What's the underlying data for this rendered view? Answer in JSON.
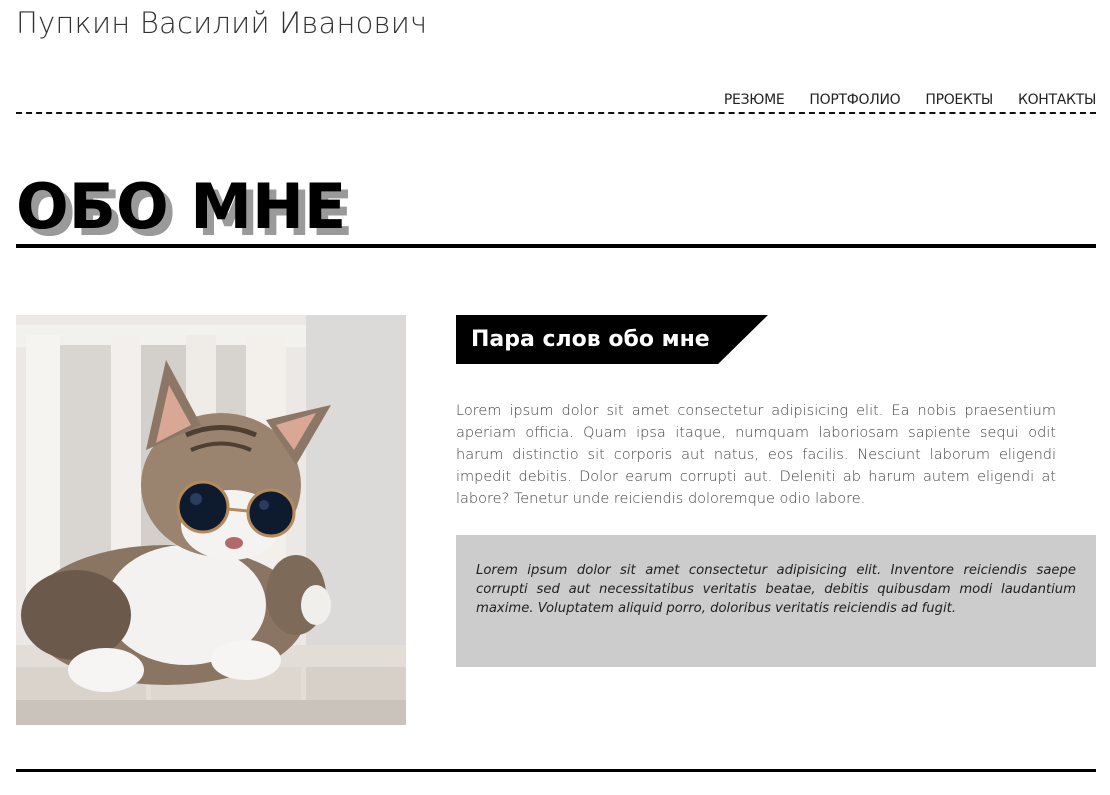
{
  "header": {
    "site_title": "Пупкин Василий Иванович"
  },
  "nav": {
    "items": [
      {
        "label": "РЕЗЮМЕ"
      },
      {
        "label": "ПОРТФОЛИО"
      },
      {
        "label": "ПРОЕКТЫ"
      },
      {
        "label": "КОНТАКТЫ"
      }
    ]
  },
  "main": {
    "heading": "ОБО МНЕ",
    "photo": {
      "alt": "Кот в солнцезащитных очках"
    },
    "subheading": "Пара слов обо мне",
    "intro_text": "Lorem ipsum dolor sit amet consectetur adipisicing elit. Ea nobis praesentium aperiam officia. Quam ipsa itaque, numquam laboriosam sapiente sequi odit harum distinctio sit corporis aut natus, eos facilis. Nesciunt laborum eligendi impedit debitis. Dolor earum corrupti aut. Deleniti ab harum autem eligendi at labore? Tenetur unde reiciendis doloremque odio labore.",
    "quote_text": "Lorem ipsum dolor sit amet consectetur adipisicing elit. Inventore reiciendis saepe corrupti sed aut necessitatibus veritatis beatae, debitis quibusdam modi laudantium maxime. Voluptatem aliquid porro, doloribus veritatis reiciendis ad fugit."
  },
  "colors": {
    "text": "#222222",
    "heading": "#000000",
    "heading_shadow": "#9a9a9a",
    "subheading_bg": "#000000",
    "quote_bg": "#cccccc"
  }
}
